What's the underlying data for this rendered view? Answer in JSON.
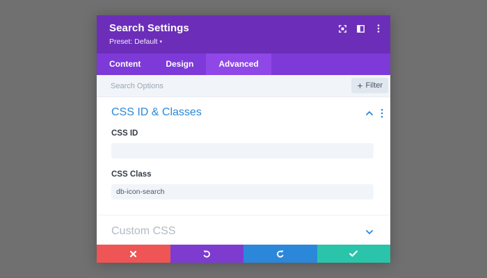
{
  "modal": {
    "title": "Search Settings",
    "preset_label": "Preset: Default",
    "preset_caret": "▾"
  },
  "header_icons": [
    "fullscreen-icon",
    "split-view-icon",
    "more-vertical-icon"
  ],
  "tabs": [
    {
      "label": "Content",
      "active": false
    },
    {
      "label": "Design",
      "active": false
    },
    {
      "label": "Advanced",
      "active": true
    }
  ],
  "search": {
    "placeholder": "Search Options",
    "filter_label": "Filter",
    "filter_icon": "+"
  },
  "sections": {
    "css_id_classes": {
      "title": "CSS ID & Classes",
      "fields": {
        "css_id": {
          "label": "CSS ID",
          "value": ""
        },
        "css_class": {
          "label": "CSS Class",
          "value": "db-icon-search"
        }
      }
    },
    "custom_css": {
      "title": "Custom CSS"
    }
  },
  "footer": {
    "buttons": [
      {
        "name": "discard",
        "icon": "close-icon",
        "color": "#ef5555"
      },
      {
        "name": "undo",
        "icon": "undo-icon",
        "color": "#7e3bd0"
      },
      {
        "name": "redo",
        "icon": "redo-icon",
        "color": "#2b87da"
      },
      {
        "name": "save",
        "icon": "check-icon",
        "color": "#29c4a9"
      }
    ]
  },
  "colors": {
    "backdrop": "#707070",
    "header": "#6c2eb9",
    "tabs": "#7d3ad8",
    "tab_active": "#8f47e8",
    "accent_blue": "#2b87da",
    "input_bg": "#f1f5f9"
  }
}
